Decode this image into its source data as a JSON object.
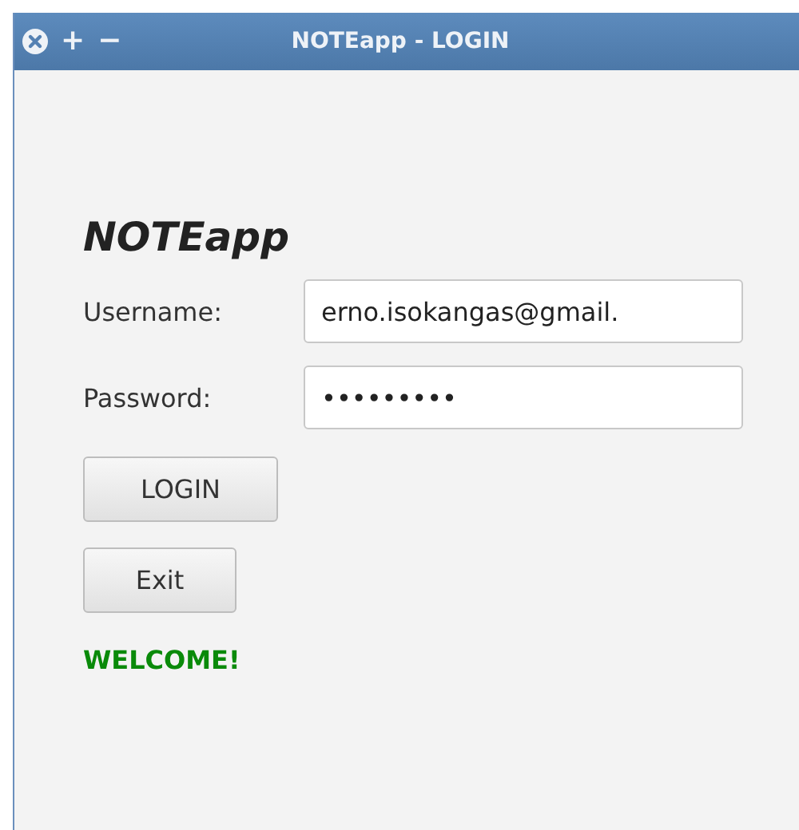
{
  "window": {
    "title": "NOTEapp - LOGIN",
    "controls": [
      "+",
      "−"
    ]
  },
  "app_title": "NOTEapp",
  "fields": [
    {
      "label": "Username:",
      "value": "erno.isokangas@gmail."
    },
    {
      "label": "Password:",
      "value": "•••••••••"
    }
  ],
  "buttons": [
    "LOGIN",
    "Exit"
  ],
  "message": "WELCOME!"
}
